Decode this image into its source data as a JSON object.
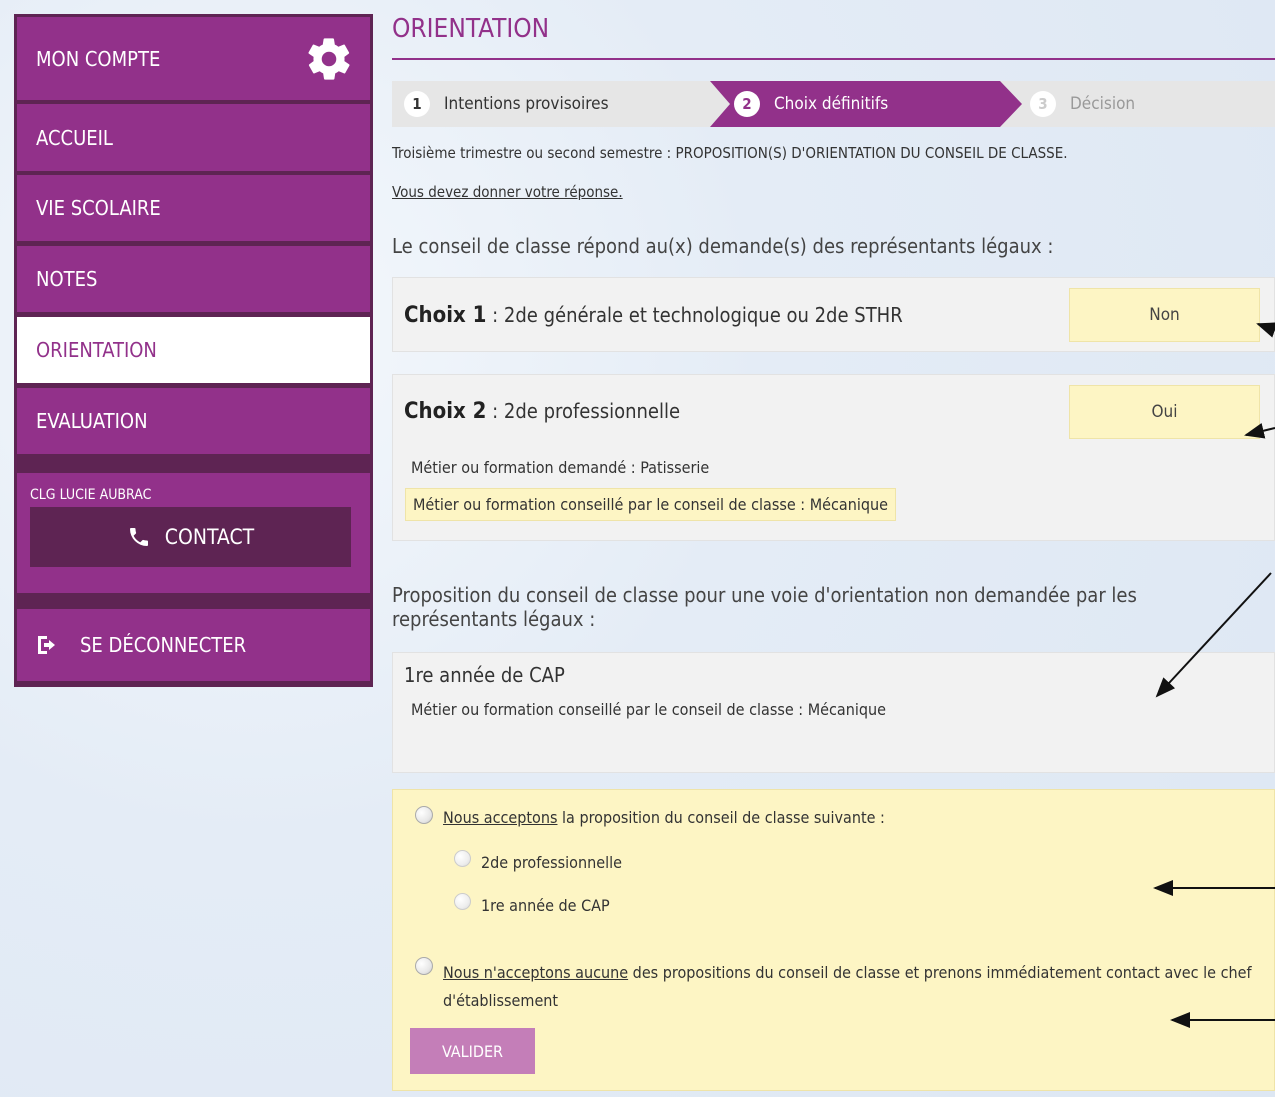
{
  "sidebar": {
    "account_label": "MON COMPTE",
    "items": [
      {
        "label": "ACCUEIL"
      },
      {
        "label": "VIE SCOLAIRE"
      },
      {
        "label": "NOTES"
      },
      {
        "label": "ORIENTATION"
      },
      {
        "label": "EVALUATION"
      }
    ],
    "active_item": "ORIENTATION",
    "school_name": "CLG LUCIE AUBRAC",
    "contact_label": "CONTACT",
    "logout_label": "SE DÉCONNECTER"
  },
  "main": {
    "title": "ORIENTATION",
    "steps": [
      {
        "number": "1",
        "label": "Intentions provisoires",
        "state": "done"
      },
      {
        "number": "2",
        "label": "Choix définitifs",
        "state": "active"
      },
      {
        "number": "3",
        "label": "Décision",
        "state": "disabled"
      }
    ],
    "subtitle": "Troisième trimestre ou second semestre : PROPOSITION(S) D'ORIENTATION DU CONSEIL DE CLASSE.",
    "answer_prompt": "Vous devez donner votre réponse.",
    "council_heading": "Le conseil de classe répond au(x) demande(s) des représentants légaux :",
    "choices": [
      {
        "prefix": "Choix 1",
        "label": "2de générale et technologique ou 2de STHR",
        "response": "Non"
      },
      {
        "prefix": "Choix 2",
        "label": "2de professionnelle",
        "response": "Oui",
        "requested": "Métier ou formation demandé : Patisserie",
        "advised": "Métier ou formation conseillé par le conseil de classe : Mécanique"
      }
    ],
    "choice_separator": " : ",
    "proposal_heading": "Proposition du conseil de classe pour une voie d'orientation non demandée par les représentants légaux :",
    "proposal": {
      "label": "1re année de CAP",
      "advised": "Métier ou formation conseillé par le conseil de classe : Mécanique"
    },
    "accept": {
      "option1_underlined": "Nous acceptons",
      "option1_rest": " la proposition du conseil de classe suivante :",
      "sub_options": [
        "2de professionnelle",
        "1re année de CAP"
      ],
      "option2_underlined": "Nous n'acceptons aucune",
      "option2_rest": " des propositions du conseil de classe et prenons immédiatement contact avec le chef d'établissement",
      "submit_label": "VALIDER"
    }
  },
  "colors": {
    "brand_purple": "#92318a",
    "dark_purple": "#5e2453",
    "highlight_yellow": "#fdf5c4",
    "button_pink": "#c47eb8"
  },
  "icons": {
    "account": "gear-icon",
    "contact": "phone-icon",
    "logout": "logout-icon"
  }
}
